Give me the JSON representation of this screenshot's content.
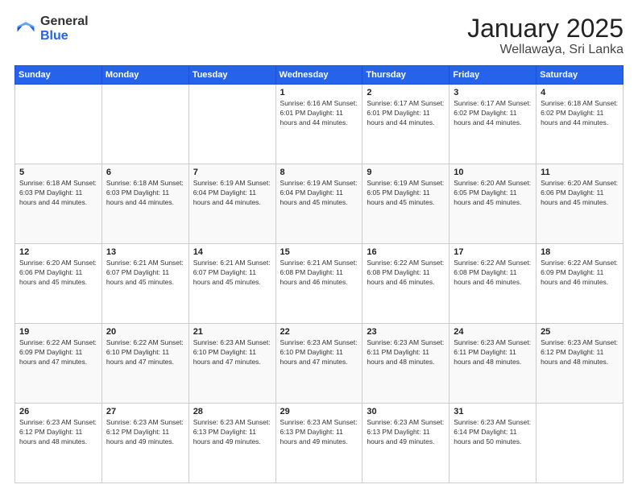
{
  "header": {
    "logo": {
      "general": "General",
      "blue": "Blue"
    },
    "title": "January 2025",
    "location": "Wellawaya, Sri Lanka"
  },
  "days_of_week": [
    "Sunday",
    "Monday",
    "Tuesday",
    "Wednesday",
    "Thursday",
    "Friday",
    "Saturday"
  ],
  "weeks": [
    [
      {
        "day": null,
        "info": null
      },
      {
        "day": null,
        "info": null
      },
      {
        "day": null,
        "info": null
      },
      {
        "day": "1",
        "info": "Sunrise: 6:16 AM\nSunset: 6:01 PM\nDaylight: 11 hours and 44 minutes."
      },
      {
        "day": "2",
        "info": "Sunrise: 6:17 AM\nSunset: 6:01 PM\nDaylight: 11 hours and 44 minutes."
      },
      {
        "day": "3",
        "info": "Sunrise: 6:17 AM\nSunset: 6:02 PM\nDaylight: 11 hours and 44 minutes."
      },
      {
        "day": "4",
        "info": "Sunrise: 6:18 AM\nSunset: 6:02 PM\nDaylight: 11 hours and 44 minutes."
      }
    ],
    [
      {
        "day": "5",
        "info": "Sunrise: 6:18 AM\nSunset: 6:03 PM\nDaylight: 11 hours and 44 minutes."
      },
      {
        "day": "6",
        "info": "Sunrise: 6:18 AM\nSunset: 6:03 PM\nDaylight: 11 hours and 44 minutes."
      },
      {
        "day": "7",
        "info": "Sunrise: 6:19 AM\nSunset: 6:04 PM\nDaylight: 11 hours and 44 minutes."
      },
      {
        "day": "8",
        "info": "Sunrise: 6:19 AM\nSunset: 6:04 PM\nDaylight: 11 hours and 45 minutes."
      },
      {
        "day": "9",
        "info": "Sunrise: 6:19 AM\nSunset: 6:05 PM\nDaylight: 11 hours and 45 minutes."
      },
      {
        "day": "10",
        "info": "Sunrise: 6:20 AM\nSunset: 6:05 PM\nDaylight: 11 hours and 45 minutes."
      },
      {
        "day": "11",
        "info": "Sunrise: 6:20 AM\nSunset: 6:06 PM\nDaylight: 11 hours and 45 minutes."
      }
    ],
    [
      {
        "day": "12",
        "info": "Sunrise: 6:20 AM\nSunset: 6:06 PM\nDaylight: 11 hours and 45 minutes."
      },
      {
        "day": "13",
        "info": "Sunrise: 6:21 AM\nSunset: 6:07 PM\nDaylight: 11 hours and 45 minutes."
      },
      {
        "day": "14",
        "info": "Sunrise: 6:21 AM\nSunset: 6:07 PM\nDaylight: 11 hours and 45 minutes."
      },
      {
        "day": "15",
        "info": "Sunrise: 6:21 AM\nSunset: 6:08 PM\nDaylight: 11 hours and 46 minutes."
      },
      {
        "day": "16",
        "info": "Sunrise: 6:22 AM\nSunset: 6:08 PM\nDaylight: 11 hours and 46 minutes."
      },
      {
        "day": "17",
        "info": "Sunrise: 6:22 AM\nSunset: 6:08 PM\nDaylight: 11 hours and 46 minutes."
      },
      {
        "day": "18",
        "info": "Sunrise: 6:22 AM\nSunset: 6:09 PM\nDaylight: 11 hours and 46 minutes."
      }
    ],
    [
      {
        "day": "19",
        "info": "Sunrise: 6:22 AM\nSunset: 6:09 PM\nDaylight: 11 hours and 47 minutes."
      },
      {
        "day": "20",
        "info": "Sunrise: 6:22 AM\nSunset: 6:10 PM\nDaylight: 11 hours and 47 minutes."
      },
      {
        "day": "21",
        "info": "Sunrise: 6:23 AM\nSunset: 6:10 PM\nDaylight: 11 hours and 47 minutes."
      },
      {
        "day": "22",
        "info": "Sunrise: 6:23 AM\nSunset: 6:10 PM\nDaylight: 11 hours and 47 minutes."
      },
      {
        "day": "23",
        "info": "Sunrise: 6:23 AM\nSunset: 6:11 PM\nDaylight: 11 hours and 48 minutes."
      },
      {
        "day": "24",
        "info": "Sunrise: 6:23 AM\nSunset: 6:11 PM\nDaylight: 11 hours and 48 minutes."
      },
      {
        "day": "25",
        "info": "Sunrise: 6:23 AM\nSunset: 6:12 PM\nDaylight: 11 hours and 48 minutes."
      }
    ],
    [
      {
        "day": "26",
        "info": "Sunrise: 6:23 AM\nSunset: 6:12 PM\nDaylight: 11 hours and 48 minutes."
      },
      {
        "day": "27",
        "info": "Sunrise: 6:23 AM\nSunset: 6:12 PM\nDaylight: 11 hours and 49 minutes."
      },
      {
        "day": "28",
        "info": "Sunrise: 6:23 AM\nSunset: 6:13 PM\nDaylight: 11 hours and 49 minutes."
      },
      {
        "day": "29",
        "info": "Sunrise: 6:23 AM\nSunset: 6:13 PM\nDaylight: 11 hours and 49 minutes."
      },
      {
        "day": "30",
        "info": "Sunrise: 6:23 AM\nSunset: 6:13 PM\nDaylight: 11 hours and 49 minutes."
      },
      {
        "day": "31",
        "info": "Sunrise: 6:23 AM\nSunset: 6:14 PM\nDaylight: 11 hours and 50 minutes."
      },
      {
        "day": null,
        "info": null
      }
    ]
  ]
}
